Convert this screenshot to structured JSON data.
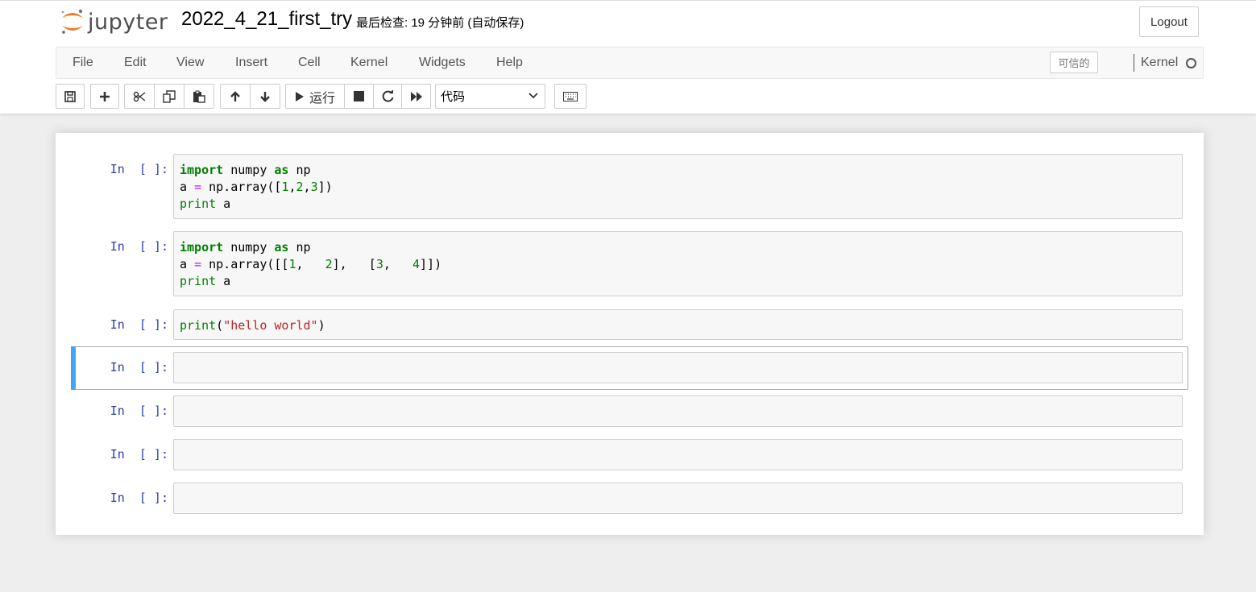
{
  "header": {
    "logo_text": "jupyter",
    "notebook_name": "2022_4_21_first_try",
    "checkpoint": "最后检查: 19 分钟前  (自动保存)",
    "logout_label": "Logout"
  },
  "menubar": {
    "items": [
      "File",
      "Edit",
      "View",
      "Insert",
      "Cell",
      "Kernel",
      "Widgets",
      "Help"
    ],
    "trusted_label": "可信的",
    "kernel_label": "Kernel"
  },
  "toolbar": {
    "run_label": "运行",
    "cell_type": "代码"
  },
  "cells": [
    {
      "prompt": "In  [ ]:",
      "lines": [
        [
          [
            "kw",
            "import"
          ],
          [
            "t",
            " numpy "
          ],
          [
            "kw",
            "as"
          ],
          [
            "t",
            " np"
          ]
        ],
        [
          [
            "t",
            "a "
          ],
          [
            "op",
            "="
          ],
          [
            "t",
            " np.array(["
          ],
          [
            "num",
            "1"
          ],
          [
            "t",
            ","
          ],
          [
            "num",
            "2"
          ],
          [
            "t",
            ","
          ],
          [
            "num",
            "3"
          ],
          [
            "t",
            "])"
          ]
        ],
        [
          [
            "bi",
            "print"
          ],
          [
            "t",
            " a"
          ]
        ]
      ]
    },
    {
      "prompt": "In  [ ]:",
      "lines": [
        [
          [
            "kw",
            "import"
          ],
          [
            "t",
            " numpy "
          ],
          [
            "kw",
            "as"
          ],
          [
            "t",
            " np"
          ]
        ],
        [
          [
            "t",
            "a "
          ],
          [
            "op",
            "="
          ],
          [
            "t",
            " np.array([["
          ],
          [
            "num",
            "1"
          ],
          [
            "t",
            ",   "
          ],
          [
            "num",
            "2"
          ],
          [
            "t",
            "],   ["
          ],
          [
            "num",
            "3"
          ],
          [
            "t",
            ",   "
          ],
          [
            "num",
            "4"
          ],
          [
            "t",
            "]])"
          ]
        ],
        [
          [
            "bi",
            "print"
          ],
          [
            "t",
            " a"
          ]
        ]
      ]
    },
    {
      "prompt": "In  [ ]:",
      "lines": [
        [
          [
            "bi",
            "print"
          ],
          [
            "t",
            "("
          ],
          [
            "str",
            "\"hello world\""
          ],
          [
            "t",
            ")"
          ]
        ]
      ]
    },
    {
      "prompt": "In  [ ]:",
      "lines": []
    },
    {
      "prompt": "In  [ ]:",
      "lines": []
    },
    {
      "prompt": "In  [ ]:",
      "lines": []
    },
    {
      "prompt": "In  [ ]:",
      "lines": []
    }
  ]
}
